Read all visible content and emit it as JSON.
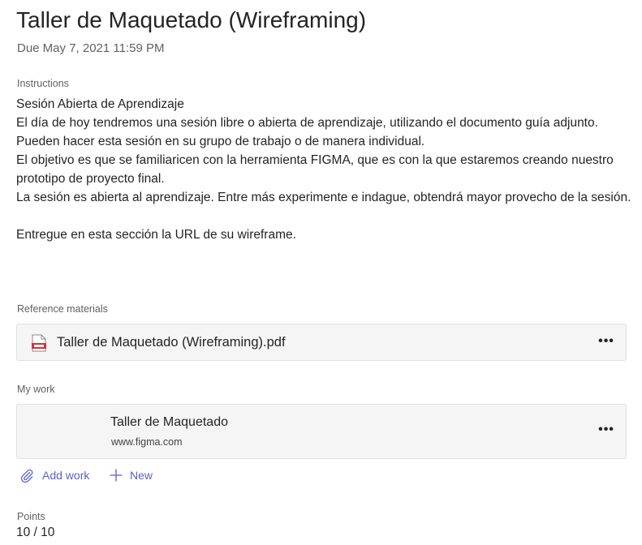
{
  "assignment": {
    "title": "Taller de Maquetado (Wireframing)",
    "due": "Due May 7, 2021 11:59 PM"
  },
  "instructions": {
    "label": "Instructions",
    "lines": [
      "Sesión Abierta de Aprendizaje",
      "El día de hoy tendremos una sesión libre o abierta de aprendizaje, utilizando el documento guía adjunto. Pueden hacer esta sesión en su grupo de trabajo o de manera individual.",
      "El objetivo es que se familiaricen con la herramienta FIGMA, que es con la que estaremos creando nuestro prototipo de proyecto final.",
      "La sesión es abierta al aprendizaje. Entre más experimente e indague, obtendrá mayor provecho de la sesión.",
      "Entregue en esta sección la URL de su wireframe."
    ]
  },
  "reference_materials": {
    "label": "Reference materials",
    "file_name": "Taller de Maquetado (Wireframing).pdf",
    "file_icon": "pdf-file-icon",
    "more_label": "•••"
  },
  "my_work": {
    "label": "My work",
    "item_title": "Taller de Maquetado",
    "item_url": "www.figma.com",
    "more_label": "•••",
    "add_work_label": "Add work",
    "new_label": "New"
  },
  "points": {
    "label": "Points",
    "value": "10 / 10"
  },
  "colors": {
    "accent": "#5b5fc7",
    "pdf_red": "#d13438"
  }
}
